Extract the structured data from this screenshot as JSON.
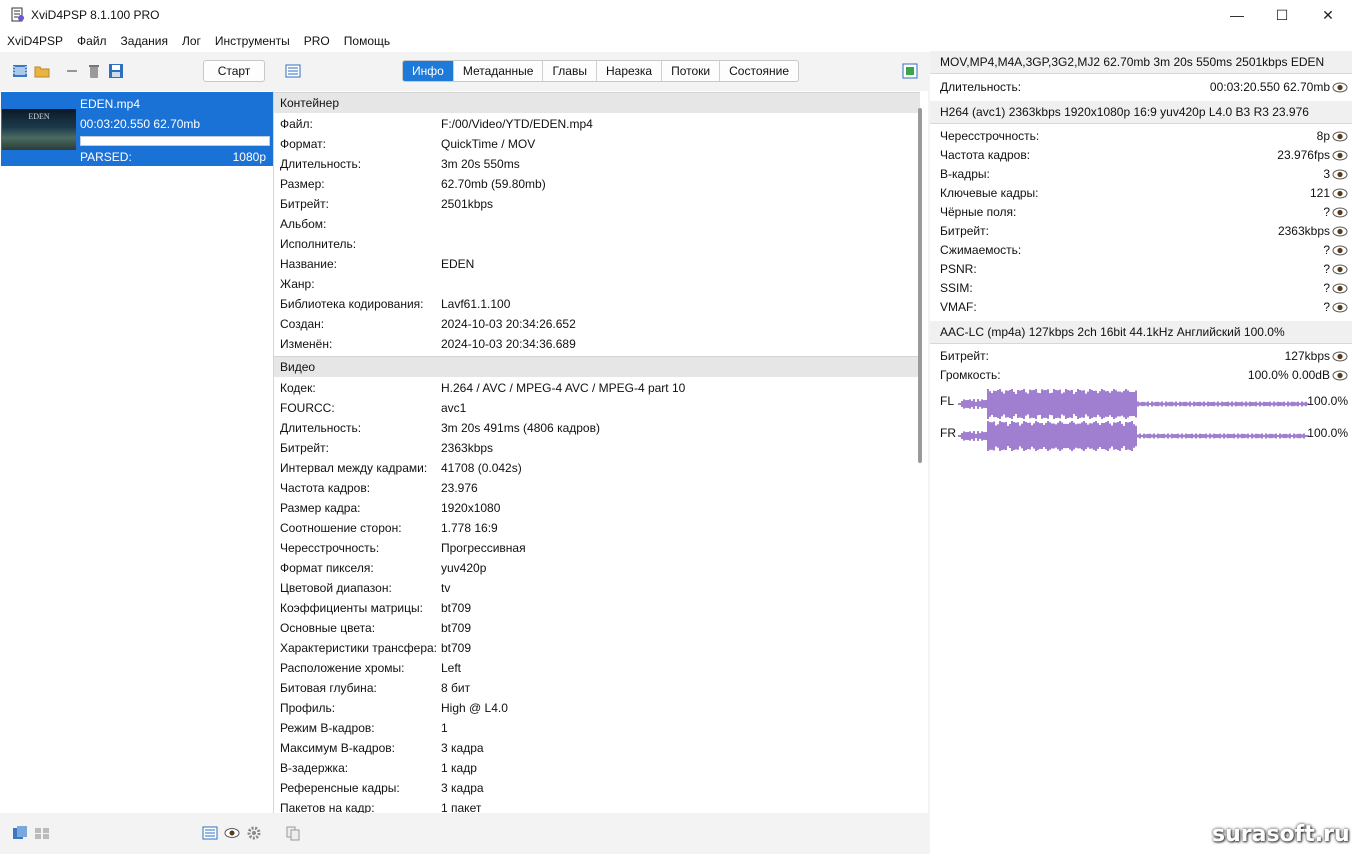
{
  "window": {
    "title": "XviD4PSP 8.1.100 PRO",
    "minimize": "—",
    "maximize": "☐",
    "close": "✕"
  },
  "menu": [
    "XviD4PSP",
    "Файл",
    "Задания",
    "Лог",
    "Инструменты",
    "PRO",
    "Помощь"
  ],
  "toolbar": {
    "start_label": "Старт"
  },
  "tabs": [
    "Инфо",
    "Метаданные",
    "Главы",
    "Нарезка",
    "Потоки",
    "Состояние"
  ],
  "file": {
    "thumb_text": "EDEN",
    "name": "EDEN.mp4",
    "meta": "00:03:20.550 62.70mb",
    "status": "PARSED:",
    "resolution": "1080p",
    "progress": 1.0
  },
  "container": {
    "title": "Контейнер",
    "rows": [
      {
        "k": "Файл:",
        "v": "F:/00/Video/YTD/EDEN.mp4"
      },
      {
        "k": "Формат:",
        "v": "QuickTime / MOV"
      },
      {
        "k": "Длительность:",
        "v": "3m 20s 550ms"
      },
      {
        "k": "Размер:",
        "v": "62.70mb (59.80mb)"
      },
      {
        "k": "Битрейт:",
        "v": "2501kbps"
      },
      {
        "k": "Альбом:",
        "v": ""
      },
      {
        "k": "Исполнитель:",
        "v": ""
      },
      {
        "k": "Название:",
        "v": "EDEN"
      },
      {
        "k": "Жанр:",
        "v": ""
      },
      {
        "k": "Библиотека кодирования:",
        "v": "Lavf61.1.100"
      },
      {
        "k": "Создан:",
        "v": "2024-10-03 20:34:26.652"
      },
      {
        "k": "Изменён:",
        "v": "2024-10-03 20:34:36.689"
      }
    ]
  },
  "video": {
    "title": "Видео",
    "rows": [
      {
        "k": "Кодек:",
        "v": "H.264 / AVC / MPEG-4 AVC / MPEG-4 part 10"
      },
      {
        "k": "FOURCC:",
        "v": "avc1"
      },
      {
        "k": "Длительность:",
        "v": "3m 20s 491ms (4806 кадров)"
      },
      {
        "k": "Битрейт:",
        "v": "2363kbps"
      },
      {
        "k": "Интервал между кадрами:",
        "v": "41708 (0.042s)"
      },
      {
        "k": "Частота кадров:",
        "v": "23.976"
      },
      {
        "k": "Размер кадра:",
        "v": "1920x1080"
      },
      {
        "k": "Соотношение сторон:",
        "v": "1.778 16:9"
      },
      {
        "k": "Чересстрочность:",
        "v": "Прогрессивная"
      },
      {
        "k": "Формат пикселя:",
        "v": "yuv420p"
      },
      {
        "k": "Цветовой диапазон:",
        "v": "tv"
      },
      {
        "k": "Коэффициенты матрицы:",
        "v": "bt709"
      },
      {
        "k": "Основные цвета:",
        "v": "bt709"
      },
      {
        "k": "Характеристики трансфера:",
        "v": "bt709"
      },
      {
        "k": "Расположение хромы:",
        "v": "Left"
      },
      {
        "k": "Битовая глубина:",
        "v": "8 бит"
      },
      {
        "k": "Профиль:",
        "v": "High @ L4.0"
      },
      {
        "k": "Режим B-кадров:",
        "v": "1"
      },
      {
        "k": "Максимум B-кадров:",
        "v": "3 кадра"
      },
      {
        "k": "B-задержка:",
        "v": "1 кадр"
      },
      {
        "k": "Референсные кадры:",
        "v": "3 кадра"
      },
      {
        "k": "Пакетов на кадр:",
        "v": "1 пакет"
      }
    ]
  },
  "summary": {
    "header": "MOV,MP4,M4A,3GP,3G2,MJ2 62.70mb 3m 20s 550ms 2501kbps EDEN",
    "duration_label": "Длительность:",
    "duration_value": "00:03:20.550 62.70mb",
    "video_header": "H264 (avc1) 2363kbps 1920x1080p 16:9 yuv420p L4.0 B3 R3 23.976",
    "video_rows": [
      {
        "k": "Чересстрочность:",
        "v": "8p"
      },
      {
        "k": "Частота кадров:",
        "v": "23.976fps"
      },
      {
        "k": "B-кадры:",
        "v": "3"
      },
      {
        "k": "Ключевые кадры:",
        "v": "121"
      },
      {
        "k": "Чёрные поля:",
        "v": "?"
      },
      {
        "k": "Битрейт:",
        "v": "2363kbps"
      },
      {
        "k": "Сжимаемость:",
        "v": "?"
      },
      {
        "k": "PSNR:",
        "v": "?"
      },
      {
        "k": "SSIM:",
        "v": "?"
      },
      {
        "k": "VMAF:",
        "v": "?"
      }
    ],
    "audio_header": "AAC-LC (mp4a) 127kbps 2ch 16bit 44.1kHz Английский 100.0%",
    "audio_rows": [
      {
        "k": "Битрейт:",
        "v": "127kbps"
      },
      {
        "k": "Громкость:",
        "v": "100.0% 0.00dB"
      }
    ],
    "channels": [
      {
        "name": "FL",
        "pct": "100.0%"
      },
      {
        "name": "FR",
        "pct": "100.0%"
      }
    ],
    "wave_color": "#a07ed0"
  },
  "watermark": "surasoft.ru",
  "colors": {
    "accent": "#1e7ad8",
    "selection": "#1a72d6"
  }
}
